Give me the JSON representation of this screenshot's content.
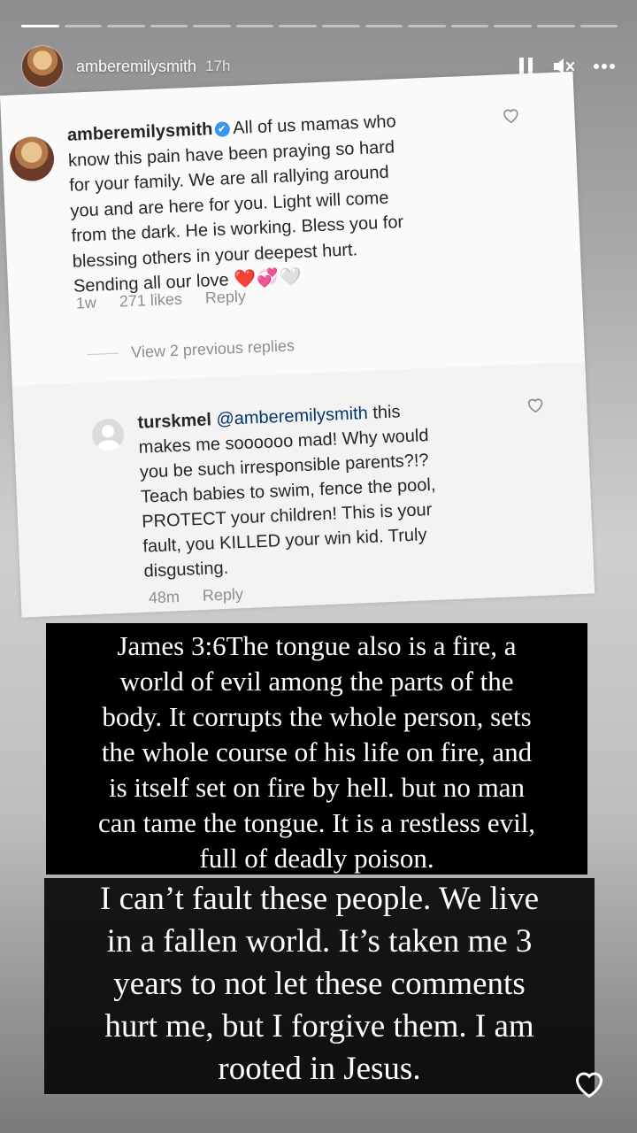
{
  "story": {
    "username": "amberemilysmith",
    "posted_ago": "17h",
    "segments_total": 14,
    "segments_done": 1,
    "icons": [
      "pause-icon",
      "mute-icon",
      "more-icon",
      "like-heart-icon"
    ]
  },
  "comment": {
    "username": "amberemilysmith",
    "verified_icon": "✔",
    "lines": [
      "All of us mamas who",
      "know this pain have been praying so hard",
      "for your family. We are all rallying around",
      "you and are here for you. Light will come",
      "from the dark. He is working. Bless you for",
      "blessing others in your deepest hurt.",
      "Sending all our love"
    ],
    "emoji": "❤️💞🤍",
    "time": "1w",
    "likes": "271 likes",
    "reply_label": "Reply",
    "view_replies": "View 2 previous replies"
  },
  "reply": {
    "username": "turskmel",
    "mention": "@amberemilysmith",
    "lines": [
      "this",
      "makes me soooooo mad! Why would",
      "you be such irresponsible parents?!?",
      "Teach babies to swim, fence the pool,",
      "PROTECT your children! This is your",
      "fault, you KILLED your win kid. Truly",
      "disgusting."
    ],
    "time": "48m",
    "reply_label": "Reply"
  },
  "quote_box": {
    "lines": [
      "James 3:6The tongue also is a fire, a",
      "world of evil among the parts of the",
      "body. It corrupts the whole person, sets",
      "the whole course of his life on fire, and",
      "is itself set on fire by hell. but no man",
      "can tame the tongue. It is a restless evil,",
      "full of deadly poison."
    ]
  },
  "statement_box": {
    "lines": [
      "I can’t fault these people. We live",
      "in a fallen world. It’s taken me 3",
      "years to not let these comments",
      "hurt me, but I forgive them. I am",
      "rooted in Jesus."
    ]
  },
  "colors": {
    "instagram_text": "#262626",
    "instagram_meta": "#8e8e8e",
    "mention": "#00376b",
    "verified_blue": "#3897f0"
  }
}
